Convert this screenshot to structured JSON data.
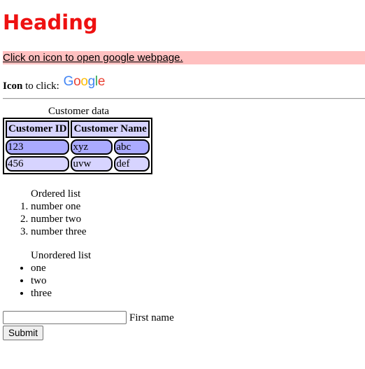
{
  "heading": "Heading",
  "link_text": "Click on icon to open google webpage.",
  "icon_row": {
    "label_bold": "Icon",
    "label_rest": " to click: ",
    "logo_letters": [
      {
        "ch": "G",
        "color": "#4285F4"
      },
      {
        "ch": "o",
        "color": "#EA4335"
      },
      {
        "ch": "o",
        "color": "#FBBC05"
      },
      {
        "ch": "g",
        "color": "#4285F4"
      },
      {
        "ch": "l",
        "color": "#34A853"
      },
      {
        "ch": "e",
        "color": "#EA4335"
      }
    ]
  },
  "table": {
    "caption": "Customer data",
    "headers": [
      "Customer ID",
      "Customer Name"
    ],
    "rows": [
      [
        "123",
        "xyz",
        "abc"
      ],
      [
        "456",
        "uvw",
        "def"
      ]
    ]
  },
  "ordered_list": {
    "title": "Ordered list",
    "items": [
      "number one",
      "number two",
      "number three"
    ]
  },
  "unordered_list": {
    "title": "Unordered list",
    "items": [
      "one",
      "two",
      "three"
    ]
  },
  "form": {
    "input_value": "",
    "input_label": "First name",
    "submit_label": "Submit"
  },
  "colors": {
    "heading": "#ee1111",
    "link_bar_bg": "#ffc0c0",
    "cell_dark": "#aaaaff",
    "cell_light": "#d7d4ff"
  }
}
